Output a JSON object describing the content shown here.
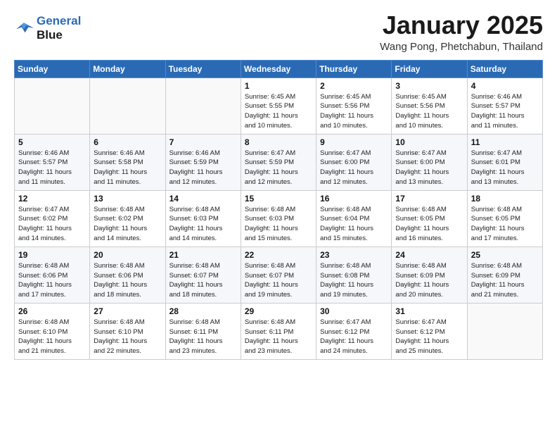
{
  "logo": {
    "line1": "General",
    "line2": "Blue"
  },
  "header": {
    "month_title": "January 2025",
    "location": "Wang Pong, Phetchabun, Thailand"
  },
  "weekdays": [
    "Sunday",
    "Monday",
    "Tuesday",
    "Wednesday",
    "Thursday",
    "Friday",
    "Saturday"
  ],
  "weeks": [
    [
      {
        "day": "",
        "info": ""
      },
      {
        "day": "",
        "info": ""
      },
      {
        "day": "",
        "info": ""
      },
      {
        "day": "1",
        "info": "Sunrise: 6:45 AM\nSunset: 5:55 PM\nDaylight: 11 hours\nand 10 minutes."
      },
      {
        "day": "2",
        "info": "Sunrise: 6:45 AM\nSunset: 5:56 PM\nDaylight: 11 hours\nand 10 minutes."
      },
      {
        "day": "3",
        "info": "Sunrise: 6:45 AM\nSunset: 5:56 PM\nDaylight: 11 hours\nand 10 minutes."
      },
      {
        "day": "4",
        "info": "Sunrise: 6:46 AM\nSunset: 5:57 PM\nDaylight: 11 hours\nand 11 minutes."
      }
    ],
    [
      {
        "day": "5",
        "info": "Sunrise: 6:46 AM\nSunset: 5:57 PM\nDaylight: 11 hours\nand 11 minutes."
      },
      {
        "day": "6",
        "info": "Sunrise: 6:46 AM\nSunset: 5:58 PM\nDaylight: 11 hours\nand 11 minutes."
      },
      {
        "day": "7",
        "info": "Sunrise: 6:46 AM\nSunset: 5:59 PM\nDaylight: 11 hours\nand 12 minutes."
      },
      {
        "day": "8",
        "info": "Sunrise: 6:47 AM\nSunset: 5:59 PM\nDaylight: 11 hours\nand 12 minutes."
      },
      {
        "day": "9",
        "info": "Sunrise: 6:47 AM\nSunset: 6:00 PM\nDaylight: 11 hours\nand 12 minutes."
      },
      {
        "day": "10",
        "info": "Sunrise: 6:47 AM\nSunset: 6:00 PM\nDaylight: 11 hours\nand 13 minutes."
      },
      {
        "day": "11",
        "info": "Sunrise: 6:47 AM\nSunset: 6:01 PM\nDaylight: 11 hours\nand 13 minutes."
      }
    ],
    [
      {
        "day": "12",
        "info": "Sunrise: 6:47 AM\nSunset: 6:02 PM\nDaylight: 11 hours\nand 14 minutes."
      },
      {
        "day": "13",
        "info": "Sunrise: 6:48 AM\nSunset: 6:02 PM\nDaylight: 11 hours\nand 14 minutes."
      },
      {
        "day": "14",
        "info": "Sunrise: 6:48 AM\nSunset: 6:03 PM\nDaylight: 11 hours\nand 14 minutes."
      },
      {
        "day": "15",
        "info": "Sunrise: 6:48 AM\nSunset: 6:03 PM\nDaylight: 11 hours\nand 15 minutes."
      },
      {
        "day": "16",
        "info": "Sunrise: 6:48 AM\nSunset: 6:04 PM\nDaylight: 11 hours\nand 15 minutes."
      },
      {
        "day": "17",
        "info": "Sunrise: 6:48 AM\nSunset: 6:05 PM\nDaylight: 11 hours\nand 16 minutes."
      },
      {
        "day": "18",
        "info": "Sunrise: 6:48 AM\nSunset: 6:05 PM\nDaylight: 11 hours\nand 17 minutes."
      }
    ],
    [
      {
        "day": "19",
        "info": "Sunrise: 6:48 AM\nSunset: 6:06 PM\nDaylight: 11 hours\nand 17 minutes."
      },
      {
        "day": "20",
        "info": "Sunrise: 6:48 AM\nSunset: 6:06 PM\nDaylight: 11 hours\nand 18 minutes."
      },
      {
        "day": "21",
        "info": "Sunrise: 6:48 AM\nSunset: 6:07 PM\nDaylight: 11 hours\nand 18 minutes."
      },
      {
        "day": "22",
        "info": "Sunrise: 6:48 AM\nSunset: 6:07 PM\nDaylight: 11 hours\nand 19 minutes."
      },
      {
        "day": "23",
        "info": "Sunrise: 6:48 AM\nSunset: 6:08 PM\nDaylight: 11 hours\nand 19 minutes."
      },
      {
        "day": "24",
        "info": "Sunrise: 6:48 AM\nSunset: 6:09 PM\nDaylight: 11 hours\nand 20 minutes."
      },
      {
        "day": "25",
        "info": "Sunrise: 6:48 AM\nSunset: 6:09 PM\nDaylight: 11 hours\nand 21 minutes."
      }
    ],
    [
      {
        "day": "26",
        "info": "Sunrise: 6:48 AM\nSunset: 6:10 PM\nDaylight: 11 hours\nand 21 minutes."
      },
      {
        "day": "27",
        "info": "Sunrise: 6:48 AM\nSunset: 6:10 PM\nDaylight: 11 hours\nand 22 minutes."
      },
      {
        "day": "28",
        "info": "Sunrise: 6:48 AM\nSunset: 6:11 PM\nDaylight: 11 hours\nand 23 minutes."
      },
      {
        "day": "29",
        "info": "Sunrise: 6:48 AM\nSunset: 6:11 PM\nDaylight: 11 hours\nand 23 minutes."
      },
      {
        "day": "30",
        "info": "Sunrise: 6:47 AM\nSunset: 6:12 PM\nDaylight: 11 hours\nand 24 minutes."
      },
      {
        "day": "31",
        "info": "Sunrise: 6:47 AM\nSunset: 6:12 PM\nDaylight: 11 hours\nand 25 minutes."
      },
      {
        "day": "",
        "info": ""
      }
    ]
  ]
}
